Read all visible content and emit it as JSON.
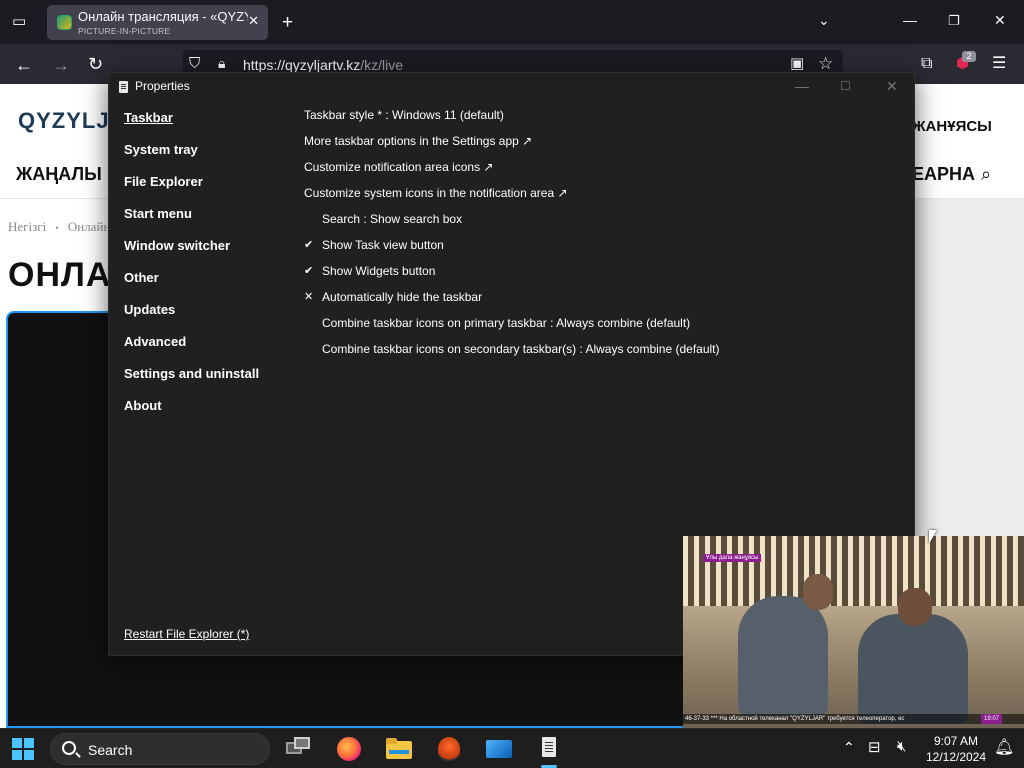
{
  "browser": {
    "tab_title": "Онлайн трансляция - «QYZYL",
    "tab_subtitle": "PICTURE-IN-PICTURE",
    "url_host": "https://qyzyljartv.kz",
    "url_path": "/kz/live",
    "extension_badge": "2"
  },
  "website": {
    "logo": "QYZYLJA",
    "nav_left": "ЖАҢАЛЫ",
    "nav_right_1": "ЖАНҰЯСЫ",
    "nav_right_2": "ЕАРНА",
    "breadcrumb_home": "Негізгі",
    "breadcrumb_sep": "•",
    "breadcrumb_current": "Онлайн",
    "page_heading": "ОНЛА"
  },
  "window": {
    "title": "Properties",
    "sidebar": [
      {
        "label": "Taskbar",
        "active": true
      },
      {
        "label": "System tray",
        "active": false
      },
      {
        "label": "File Explorer",
        "active": false
      },
      {
        "label": "Start menu",
        "active": false
      },
      {
        "label": "Window switcher",
        "active": false
      },
      {
        "label": "Other",
        "active": false
      },
      {
        "label": "Updates",
        "active": false
      },
      {
        "label": "Advanced",
        "active": false
      },
      {
        "label": "Settings and uninstall",
        "active": false
      },
      {
        "label": "About",
        "active": false
      }
    ],
    "restart_link": "Restart File Explorer (*)",
    "options": [
      {
        "text": "Taskbar style * : Windows 11 (default)",
        "mark": "",
        "indented": false
      },
      {
        "text": "More taskbar options in the Settings app ↗",
        "mark": "",
        "indented": false
      },
      {
        "text": "Customize notification area icons ↗",
        "mark": "",
        "indented": false
      },
      {
        "text": "Customize system icons in the notification area ↗",
        "mark": "",
        "indented": false
      },
      {
        "text": "Search : Show search box",
        "mark": "",
        "indented": true
      },
      {
        "text": "Show Task view button",
        "mark": "✔",
        "indented": true
      },
      {
        "text": "Show Widgets button",
        "mark": "✔",
        "indented": true
      },
      {
        "text": "Automatically hide the taskbar",
        "mark": "✕",
        "indented": true
      },
      {
        "text": "Combine taskbar icons on primary taskbar : Always combine (default)",
        "mark": "",
        "indented": true
      },
      {
        "text": "Combine taskbar icons on secondary taskbar(s) : Always combine (default)",
        "mark": "",
        "indented": true
      }
    ]
  },
  "pip": {
    "top_tag": "Ұлы дала жанұясы",
    "ticker": "46-37-33 *** На областной телеканал \"QYZYLJAR\" требуется телеоператор, ес",
    "clock": "19:07"
  },
  "taskbar": {
    "search_label": "Search",
    "time": "9:07 AM",
    "date": "12/12/2024"
  },
  "colors": {
    "window_bg": "#202020",
    "browser_tab_bg": "#42414d",
    "start_blue": "#4cc2ff",
    "player_border": "#2196f3"
  }
}
